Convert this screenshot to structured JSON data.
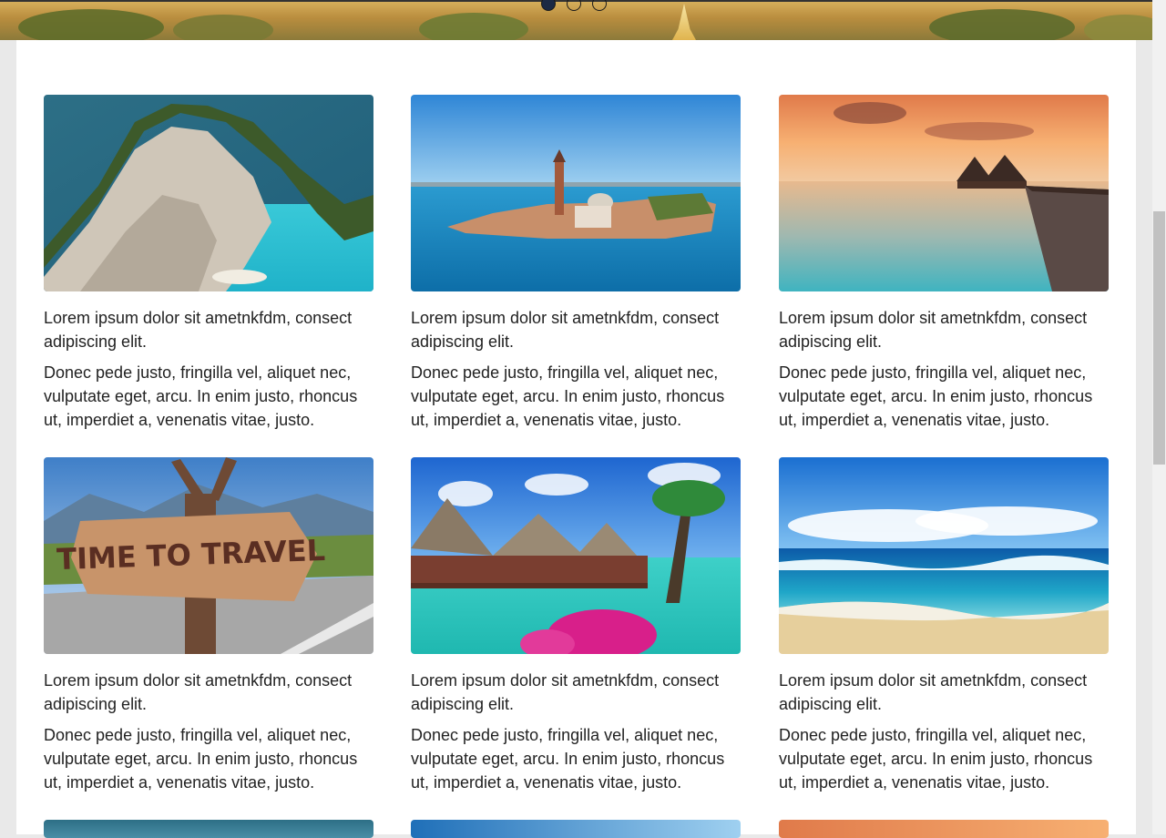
{
  "carousel": {
    "indicators": [
      {
        "label": "slide-1",
        "active": true
      },
      {
        "label": "slide-2",
        "active": false
      },
      {
        "label": "slide-3",
        "active": false
      }
    ]
  },
  "cards": [
    {
      "image": "zakynthos-cliff-bay",
      "title": "Lorem ipsum dolor sit ametnkfdm, consect adipiscing elit.",
      "text": "Donec pede justo, fringilla vel, aliquet nec, vulputate eget, arcu. In enim justo, rhoncus ut, imperdiet a, venenatis vitae, justo."
    },
    {
      "image": "venice-island",
      "title": "Lorem ipsum dolor sit ametnkfdm, consect adipiscing elit.",
      "text": "Donec pede justo, fringilla vel, aliquet nec, vulputate eget, arcu. In enim justo, rhoncus ut, imperdiet a, venenatis vitae, justo."
    },
    {
      "image": "sunset-overwater-bungalows",
      "title": "Lorem ipsum dolor sit ametnkfdm, consect adipiscing elit.",
      "text": "Donec pede justo, fringilla vel, aliquet nec, vulputate eget, arcu. In enim justo, rhoncus ut, imperdiet a, venenatis vitae, justo."
    },
    {
      "image": "time-to-travel-sign",
      "sign_text": "TIME TO TRAVEL",
      "title": "Lorem ipsum dolor sit ametnkfdm, consect adipiscing elit.",
      "text": "Donec pede justo, fringilla vel, aliquet nec, vulputate eget, arcu. In enim justo, rhoncus ut, imperdiet a, venenatis vitae, justo."
    },
    {
      "image": "tropical-bungalows-flowers",
      "title": "Lorem ipsum dolor sit ametnkfdm, consect adipiscing elit.",
      "text": "Donec pede justo, fringilla vel, aliquet nec, vulputate eget, arcu. In enim justo, rhoncus ut, imperdiet a, venenatis vitae, justo."
    },
    {
      "image": "beach-waves",
      "title": "Lorem ipsum dolor sit ametnkfdm, consect adipiscing elit.",
      "text": "Donec pede justo, fringilla vel, aliquet nec, vulputate eget, arcu. In enim justo, rhoncus ut, imperdiet a, venenatis vitae, justo."
    }
  ],
  "colors": {
    "accent": "#1c2a44",
    "text": "#222222",
    "background": "#ffffff"
  }
}
